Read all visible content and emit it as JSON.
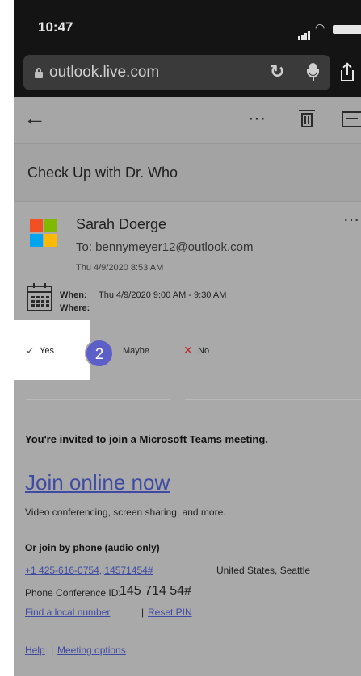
{
  "status_bar": {
    "time": "10:47"
  },
  "browser": {
    "url": "outlook.live.com"
  },
  "email": {
    "subject": "Check Up with Dr. Who",
    "sender": "Sarah Doerge",
    "to": "To: bennymeyer12@outlook.com",
    "date": "Thu 4/9/2020 8:53 AM",
    "when_label": "When:",
    "when_value": "Thu 4/9/2020 9:00 AM - 9:30 AM",
    "where_label": "Where:",
    "responses": {
      "yes": "Yes",
      "maybe": "Maybe",
      "no": "No"
    },
    "step_badge": "2",
    "invite_text": "You're invited to join a Microsoft Teams meeting.",
    "join_link": "Join online now",
    "join_sub": "Video conferencing, screen sharing, and more.",
    "phone_heading": "Or join by phone (audio only)",
    "phone_number": "+1 425-616-0754,,14571454#",
    "phone_location": "United States, Seattle",
    "conference_label": "Phone Conference ID:",
    "conference_id": "145 714 54#",
    "local_number_link": "Find a local number",
    "separator": "|",
    "reset_pin_link": "Reset PIN",
    "help_link": "Help",
    "meeting_options_link": "Meeting options"
  },
  "icons": {
    "back": "back-arrow-icon",
    "more": "more-icon",
    "delete": "trash-icon",
    "archive": "archive-icon",
    "calendar": "calendar-icon"
  },
  "colors": {
    "badge": "#5b5fc7",
    "link": "#3f4aa4",
    "decline": "#c02a2a"
  }
}
